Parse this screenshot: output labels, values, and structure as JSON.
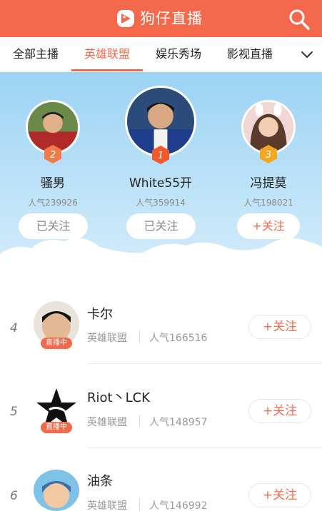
{
  "header": {
    "title": "狗仔直播"
  },
  "tabs": [
    {
      "label": "全部主播"
    },
    {
      "label": "英雄联盟"
    },
    {
      "label": "娱乐秀场"
    },
    {
      "label": "影视直播"
    }
  ],
  "top3": [
    {
      "rank": "1",
      "name": "White55开",
      "popularity": "人气359914",
      "button": "已关注",
      "followed": true
    },
    {
      "rank": "2",
      "name": "骚男",
      "popularity": "人气239926",
      "button": "已关注",
      "followed": true
    },
    {
      "rank": "3",
      "name": "冯提莫",
      "popularity": "人气198021",
      "button": "+关注",
      "followed": false
    }
  ],
  "list": [
    {
      "rank": "4",
      "name": "卡尔",
      "category": "英雄联盟",
      "popularity": "人气166516",
      "live_tag": "直播中",
      "button": "+关注"
    },
    {
      "rank": "5",
      "name": "Riot丶LCK",
      "category": "英雄联盟",
      "popularity": "人气148957",
      "live_tag": "直播中",
      "button": "+关注"
    },
    {
      "rank": "6",
      "name": "油条",
      "category": "英雄联盟",
      "popularity": "人气146992",
      "live_tag": "",
      "button": "+关注"
    }
  ],
  "colors": {
    "accent": "#f4694b",
    "sky": "#9bd3f3",
    "rank1": "#f05a2b",
    "rank2": "#f07a4b",
    "rank3": "#f5a623"
  },
  "icons": {
    "logo": "dog-logo-icon",
    "search": "search-icon",
    "more": "chevron-down-icon"
  }
}
